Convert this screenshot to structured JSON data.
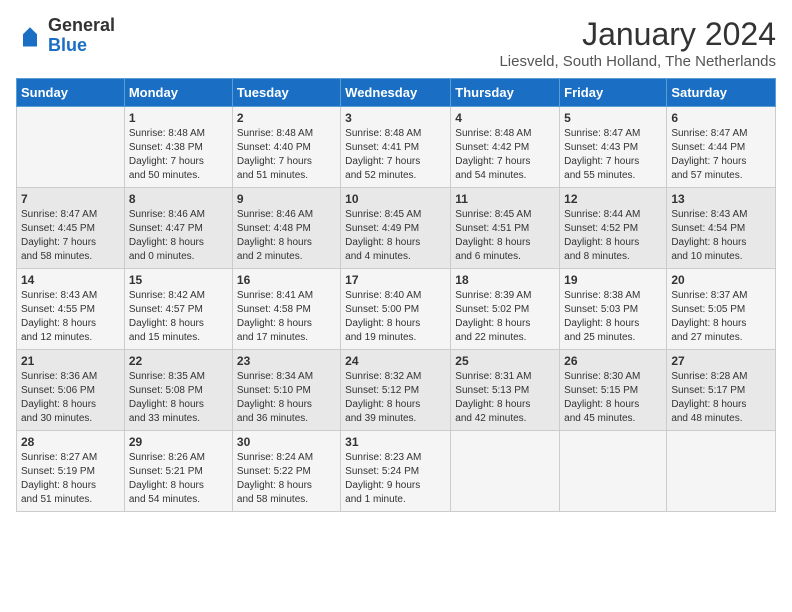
{
  "header": {
    "logo_general": "General",
    "logo_blue": "Blue",
    "month_title": "January 2024",
    "location": "Liesveld, South Holland, The Netherlands"
  },
  "weekdays": [
    "Sunday",
    "Monday",
    "Tuesday",
    "Wednesday",
    "Thursday",
    "Friday",
    "Saturday"
  ],
  "weeks": [
    [
      {
        "day": "",
        "info": ""
      },
      {
        "day": "1",
        "info": "Sunrise: 8:48 AM\nSunset: 4:38 PM\nDaylight: 7 hours\nand 50 minutes."
      },
      {
        "day": "2",
        "info": "Sunrise: 8:48 AM\nSunset: 4:40 PM\nDaylight: 7 hours\nand 51 minutes."
      },
      {
        "day": "3",
        "info": "Sunrise: 8:48 AM\nSunset: 4:41 PM\nDaylight: 7 hours\nand 52 minutes."
      },
      {
        "day": "4",
        "info": "Sunrise: 8:48 AM\nSunset: 4:42 PM\nDaylight: 7 hours\nand 54 minutes."
      },
      {
        "day": "5",
        "info": "Sunrise: 8:47 AM\nSunset: 4:43 PM\nDaylight: 7 hours\nand 55 minutes."
      },
      {
        "day": "6",
        "info": "Sunrise: 8:47 AM\nSunset: 4:44 PM\nDaylight: 7 hours\nand 57 minutes."
      }
    ],
    [
      {
        "day": "7",
        "info": "Sunrise: 8:47 AM\nSunset: 4:45 PM\nDaylight: 7 hours\nand 58 minutes."
      },
      {
        "day": "8",
        "info": "Sunrise: 8:46 AM\nSunset: 4:47 PM\nDaylight: 8 hours\nand 0 minutes."
      },
      {
        "day": "9",
        "info": "Sunrise: 8:46 AM\nSunset: 4:48 PM\nDaylight: 8 hours\nand 2 minutes."
      },
      {
        "day": "10",
        "info": "Sunrise: 8:45 AM\nSunset: 4:49 PM\nDaylight: 8 hours\nand 4 minutes."
      },
      {
        "day": "11",
        "info": "Sunrise: 8:45 AM\nSunset: 4:51 PM\nDaylight: 8 hours\nand 6 minutes."
      },
      {
        "day": "12",
        "info": "Sunrise: 8:44 AM\nSunset: 4:52 PM\nDaylight: 8 hours\nand 8 minutes."
      },
      {
        "day": "13",
        "info": "Sunrise: 8:43 AM\nSunset: 4:54 PM\nDaylight: 8 hours\nand 10 minutes."
      }
    ],
    [
      {
        "day": "14",
        "info": "Sunrise: 8:43 AM\nSunset: 4:55 PM\nDaylight: 8 hours\nand 12 minutes."
      },
      {
        "day": "15",
        "info": "Sunrise: 8:42 AM\nSunset: 4:57 PM\nDaylight: 8 hours\nand 15 minutes."
      },
      {
        "day": "16",
        "info": "Sunrise: 8:41 AM\nSunset: 4:58 PM\nDaylight: 8 hours\nand 17 minutes."
      },
      {
        "day": "17",
        "info": "Sunrise: 8:40 AM\nSunset: 5:00 PM\nDaylight: 8 hours\nand 19 minutes."
      },
      {
        "day": "18",
        "info": "Sunrise: 8:39 AM\nSunset: 5:02 PM\nDaylight: 8 hours\nand 22 minutes."
      },
      {
        "day": "19",
        "info": "Sunrise: 8:38 AM\nSunset: 5:03 PM\nDaylight: 8 hours\nand 25 minutes."
      },
      {
        "day": "20",
        "info": "Sunrise: 8:37 AM\nSunset: 5:05 PM\nDaylight: 8 hours\nand 27 minutes."
      }
    ],
    [
      {
        "day": "21",
        "info": "Sunrise: 8:36 AM\nSunset: 5:06 PM\nDaylight: 8 hours\nand 30 minutes."
      },
      {
        "day": "22",
        "info": "Sunrise: 8:35 AM\nSunset: 5:08 PM\nDaylight: 8 hours\nand 33 minutes."
      },
      {
        "day": "23",
        "info": "Sunrise: 8:34 AM\nSunset: 5:10 PM\nDaylight: 8 hours\nand 36 minutes."
      },
      {
        "day": "24",
        "info": "Sunrise: 8:32 AM\nSunset: 5:12 PM\nDaylight: 8 hours\nand 39 minutes."
      },
      {
        "day": "25",
        "info": "Sunrise: 8:31 AM\nSunset: 5:13 PM\nDaylight: 8 hours\nand 42 minutes."
      },
      {
        "day": "26",
        "info": "Sunrise: 8:30 AM\nSunset: 5:15 PM\nDaylight: 8 hours\nand 45 minutes."
      },
      {
        "day": "27",
        "info": "Sunrise: 8:28 AM\nSunset: 5:17 PM\nDaylight: 8 hours\nand 48 minutes."
      }
    ],
    [
      {
        "day": "28",
        "info": "Sunrise: 8:27 AM\nSunset: 5:19 PM\nDaylight: 8 hours\nand 51 minutes."
      },
      {
        "day": "29",
        "info": "Sunrise: 8:26 AM\nSunset: 5:21 PM\nDaylight: 8 hours\nand 54 minutes."
      },
      {
        "day": "30",
        "info": "Sunrise: 8:24 AM\nSunset: 5:22 PM\nDaylight: 8 hours\nand 58 minutes."
      },
      {
        "day": "31",
        "info": "Sunrise: 8:23 AM\nSunset: 5:24 PM\nDaylight: 9 hours\nand 1 minute."
      },
      {
        "day": "",
        "info": ""
      },
      {
        "day": "",
        "info": ""
      },
      {
        "day": "",
        "info": ""
      }
    ]
  ]
}
